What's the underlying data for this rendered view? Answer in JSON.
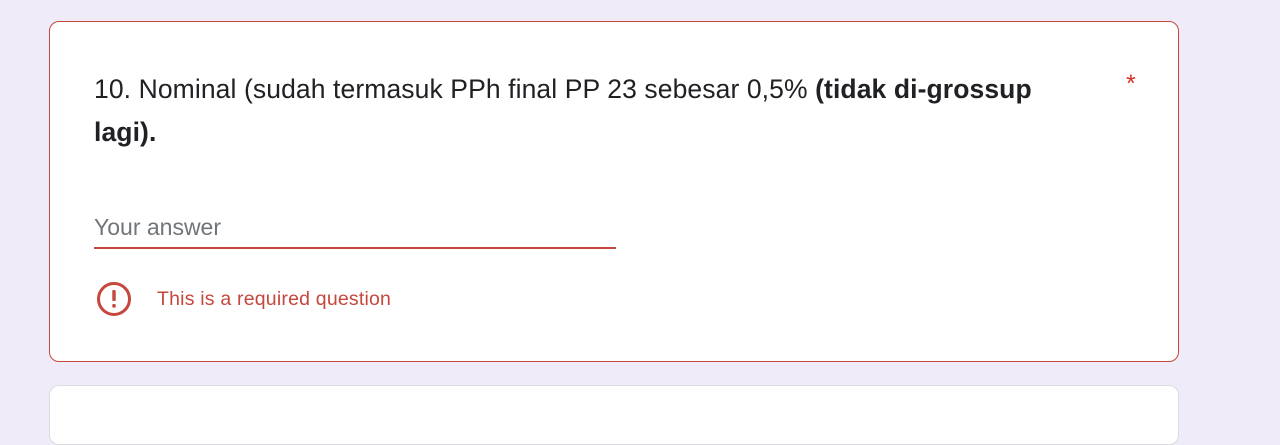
{
  "question": {
    "text_plain": "10. Nominal (sudah termasuk PPh final PP 23 sebesar 0,5% ",
    "text_bold": "(tidak di-grossup lagi).",
    "required_marker": "*"
  },
  "answer": {
    "value": "",
    "placeholder": "Your answer"
  },
  "validation": {
    "message": "This is a required question",
    "icon": "error-icon"
  },
  "colors": {
    "background": "#f0ebf8",
    "card": "#ffffff",
    "error": "#c5473d",
    "text": "#202124",
    "placeholder": "#70757a"
  }
}
